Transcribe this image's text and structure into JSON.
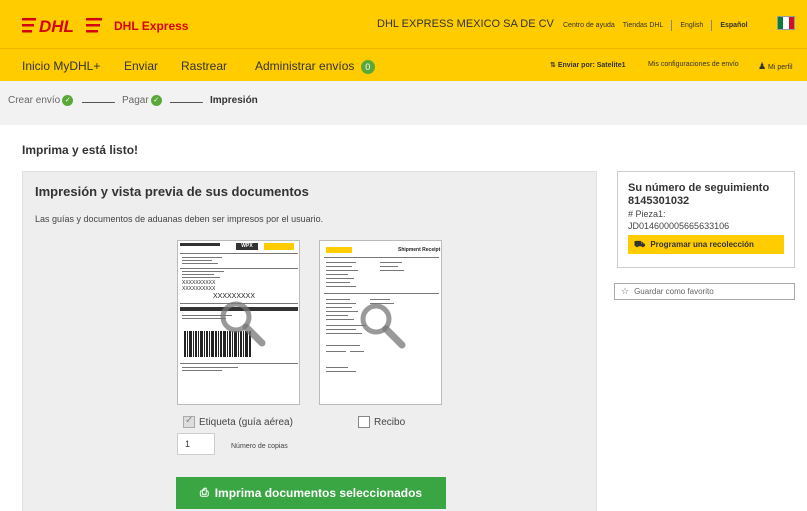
{
  "header": {
    "brand": "DHL",
    "brand_sub": "DHL Express",
    "company": "DHL EXPRESS MEXICO SA DE CV",
    "links": [
      "Centro de ayuda",
      "Tiendas DHL",
      "English",
      "Español"
    ],
    "colors": {
      "yellow": "#ffcc00",
      "red": "#d40511",
      "green": "#3aa543"
    }
  },
  "nav": {
    "items": [
      "Inicio MyDHL+",
      "Enviar",
      "Rastrear",
      "Administrar envíos"
    ],
    "badge": "0",
    "right": [
      "Enviar por: Satelite1",
      "Mis configuraciones de envío",
      "Mi perfil"
    ]
  },
  "steps": [
    "Crear envío",
    "Pagar",
    "Impresión"
  ],
  "page_title": "Imprima y está listo!",
  "panel": {
    "title": "Impresión y vista previa de sus documentos",
    "subtitle": "Las guías y documentos de aduanas deben ser impresos por el usuario.",
    "label_doc": {
      "tag": "WPX",
      "xx1": "XXXXXXXXXX",
      "xx2": "XXXXXXXXXX",
      "xx3": "XXXXXXXXX"
    },
    "receipt_doc": {
      "title": "Shipment Receipt"
    },
    "checkbox_label": "Etiqueta (guía aérea)",
    "checkbox_label_checked": true,
    "checkbox_receipt": "Recibo",
    "checkbox_receipt_checked": false,
    "copies_value": "1",
    "copies_label": "Número de copias",
    "print_button": "Imprima documentos seleccionados"
  },
  "tracking": {
    "title": "Su número de seguimiento",
    "number": "8145301032",
    "piece_label": "# Pieza1:",
    "piece_id": "JD014600005665633106",
    "pickup_button": "Programar una recolección"
  },
  "favorite": {
    "label": "Guardar como favorito"
  }
}
